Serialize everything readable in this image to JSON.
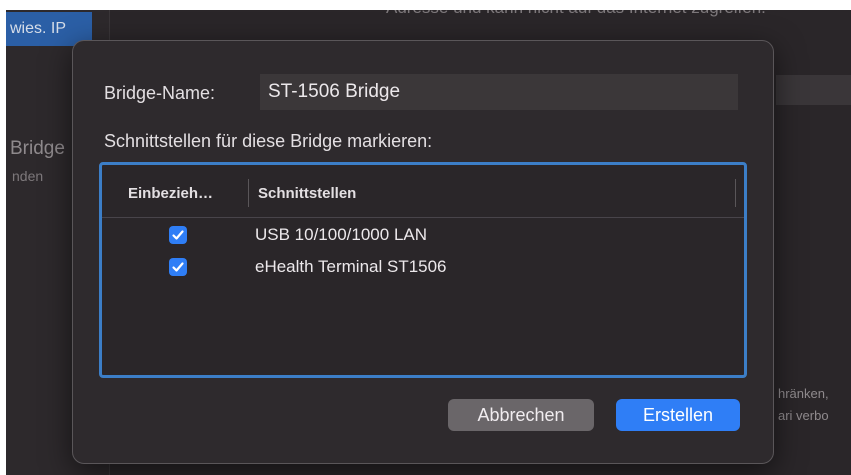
{
  "background": {
    "selected_tab": "wies. IP",
    "top_text": "Adresse und kann nicht auf das Internet zugreifen.",
    "bridge_text": "Bridge",
    "nden_text": "nden",
    "right_text_1": "hränken,",
    "right_text_2": "ari verbo"
  },
  "dialog": {
    "name_label": "Bridge-Name:",
    "name_value": "ST-1506 Bridge",
    "prompt": "Schnittstellen für diese Bridge markieren:",
    "table": {
      "columns": [
        "Einbezieh…",
        "Schnittstellen"
      ],
      "rows": [
        {
          "checked": true,
          "label": "USB 10/100/1000 LAN"
        },
        {
          "checked": true,
          "label": "eHealth Terminal ST1506"
        }
      ]
    },
    "buttons": {
      "cancel": "Abbrechen",
      "create": "Erstellen"
    }
  },
  "colors": {
    "accent": "#2f7ef6",
    "focus_ring": "#3c7ec7",
    "dialog_bg": "#2e2a2d"
  },
  "icons": {
    "checkbox": "checkmark-icon"
  }
}
